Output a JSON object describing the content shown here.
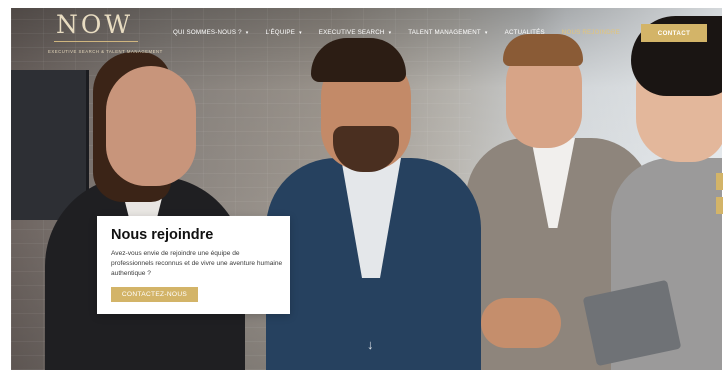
{
  "brand": {
    "logo": "NOW",
    "tagline": "EXECUTIVE SEARCH & TALENT MANAGEMENT"
  },
  "nav": {
    "items": [
      {
        "label": "QUI SOMMES-NOUS ?",
        "caret": "▾"
      },
      {
        "label": "L'ÉQUIPE",
        "caret": "▾"
      },
      {
        "label": "EXECUTIVE SEARCH",
        "caret": "▾"
      },
      {
        "label": "TALENT MANAGEMENT",
        "caret": "▾"
      },
      {
        "label": "ACTUALITÉS",
        "caret": ""
      },
      {
        "label": "NOUS REJOINDRE",
        "caret": ""
      }
    ],
    "contact_label": "CONTACT"
  },
  "hero": {
    "title": "Nous rejoindre",
    "text": "Avez-vous envie de rejoindre une équipe de professionnels reconnus et de vivre une aventure humaine authentique ?",
    "button_label": "CONTACTEZ-NOUS",
    "scroll_icon": "↓"
  },
  "colors": {
    "accent": "#d3b468",
    "logo": "#e8dcc1"
  },
  "icons": {
    "scroll": "arrow-down-icon",
    "dropdown": "chevron-down-icon"
  }
}
